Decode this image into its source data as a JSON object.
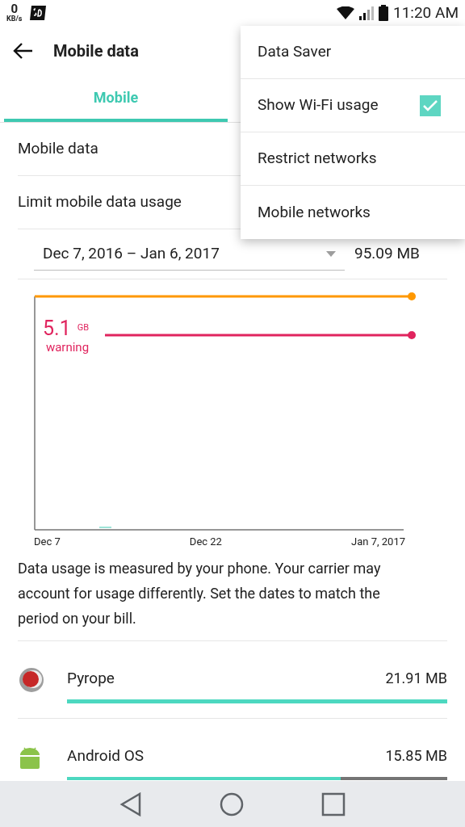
{
  "status_bar": {
    "speed_value": "0",
    "speed_unit": "KB/s",
    "time": "11:20 AM"
  },
  "toolbar": {
    "title": "Mobile data"
  },
  "tabs": [
    {
      "label": "Mobile",
      "selected": true
    }
  ],
  "settings": [
    {
      "label": "Mobile data"
    },
    {
      "label": "Limit mobile data usage"
    }
  ],
  "cycle": {
    "range": "Dec 7, 2016 – Jan 6, 2017",
    "total": "95.09 MB"
  },
  "chart": {
    "warning_value": "5.1",
    "warning_unit": "GB",
    "warning_label": "warning",
    "x_labels": [
      "Dec 7",
      "Dec 22",
      "Jan 7, 2017"
    ]
  },
  "note": "Data usage is measured by your phone. Your carrier may account for usage differently. Set the dates to match the period on your bill.",
  "apps": [
    {
      "kind": "pyrope",
      "name": "Pyrope",
      "usage": "21.91 MB",
      "level": 1
    },
    {
      "kind": "android",
      "name": "Android OS",
      "usage": "15.85 MB",
      "level": 0.72
    }
  ],
  "menu": [
    {
      "label": "Data Saver",
      "kind": "plain"
    },
    {
      "label": "Show Wi-Fi usage",
      "checked": true,
      "kind": "checkbox"
    },
    {
      "label": "Restrict networks",
      "kind": "plain"
    },
    {
      "label": "Mobile networks",
      "kind": "plain"
    }
  ]
}
